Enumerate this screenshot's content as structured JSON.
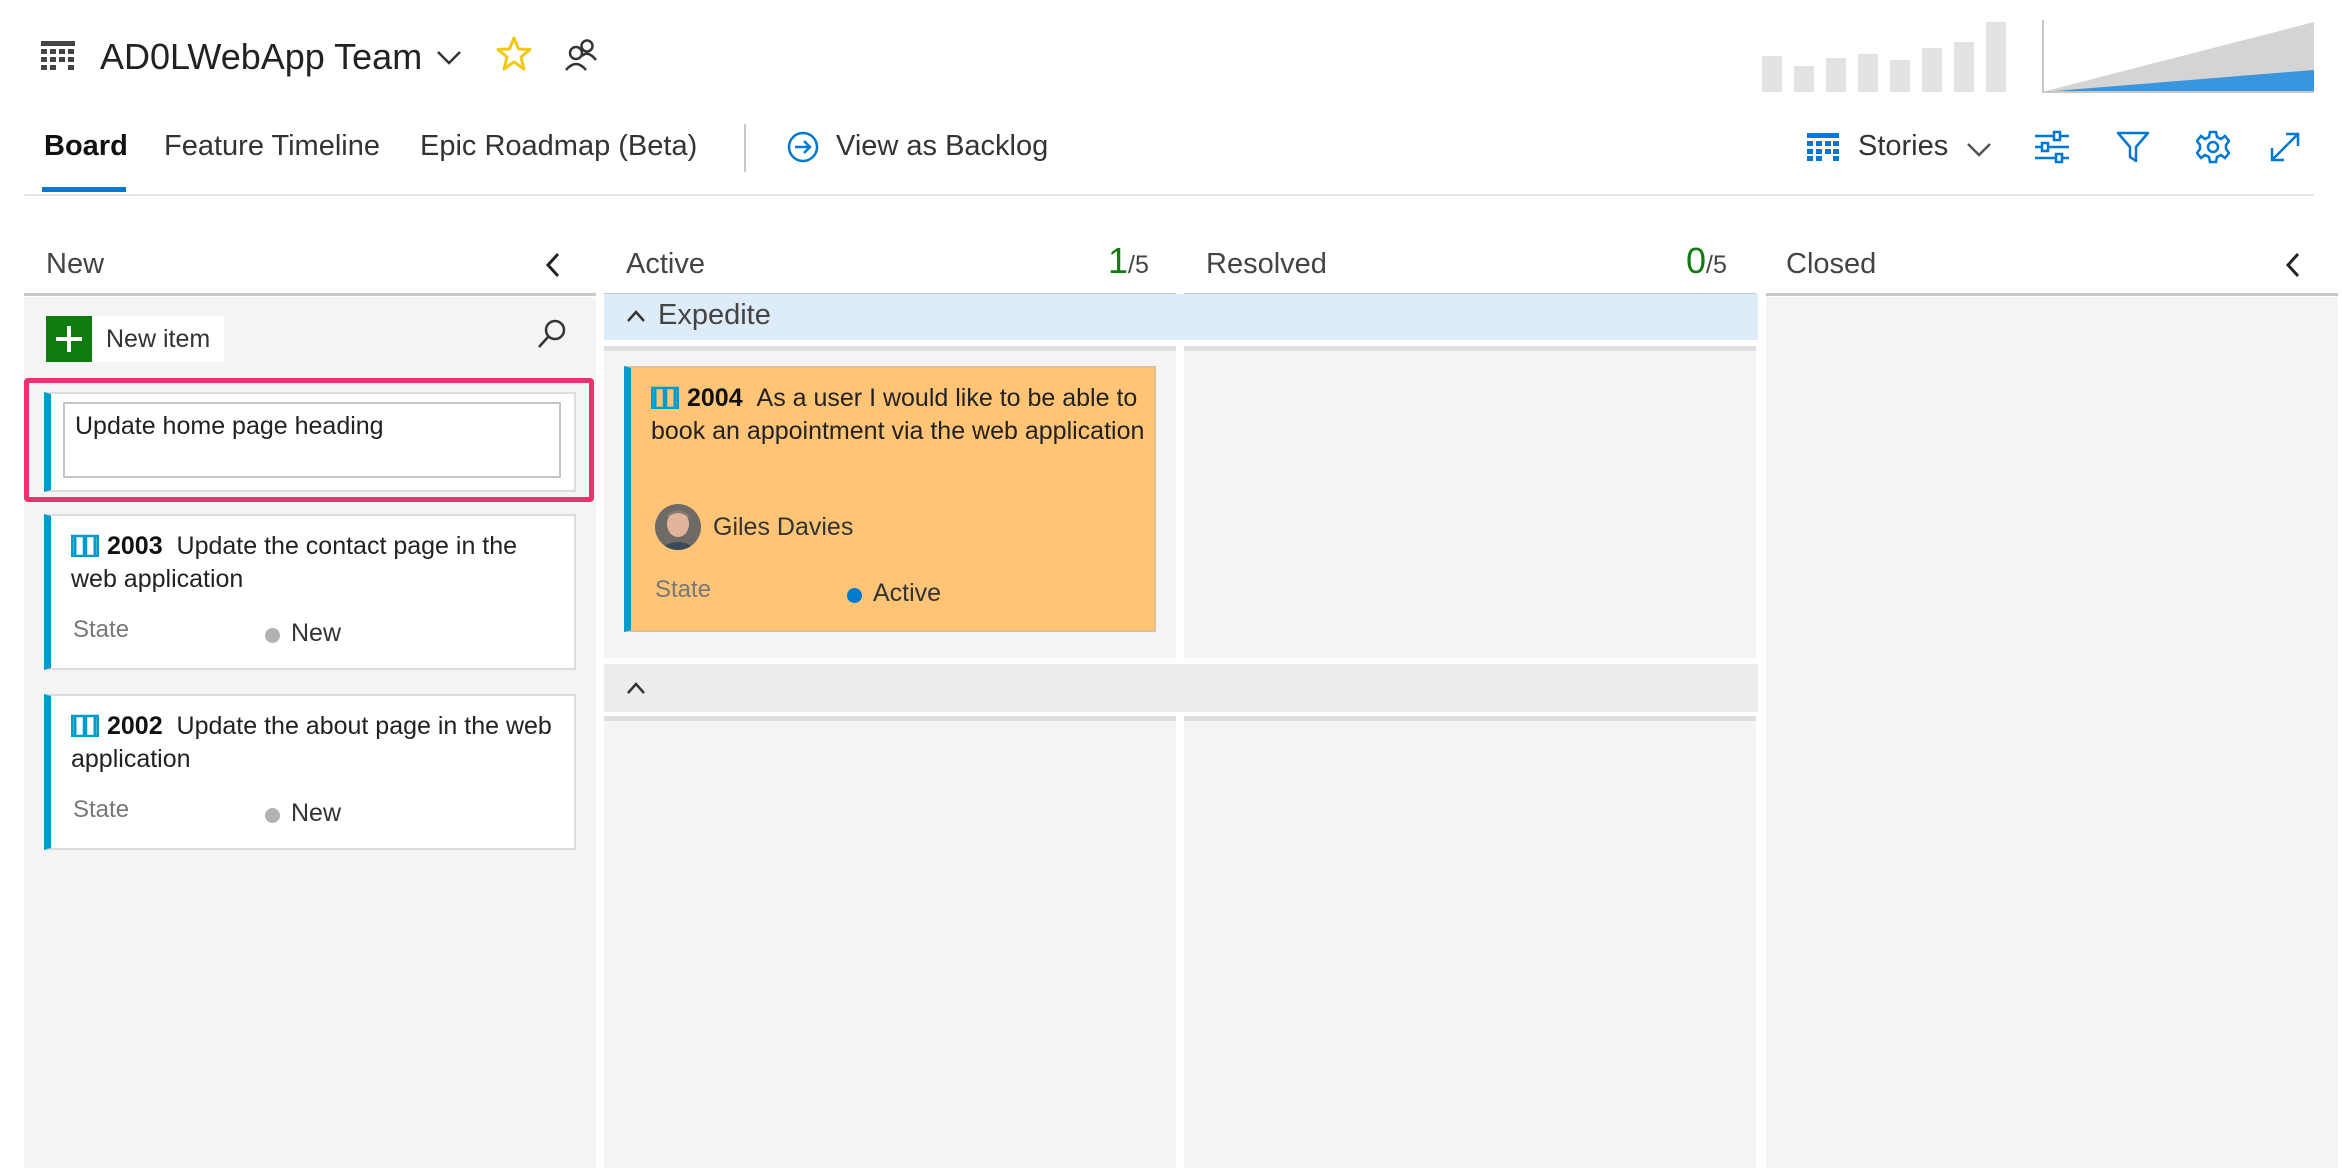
{
  "header": {
    "team_name": "AD0LWebApp Team",
    "icons": [
      "board-grid-icon",
      "chevron-down-icon",
      "favorite-star-icon",
      "team-members-icon"
    ],
    "star_color": "#f2c811"
  },
  "tabs": [
    {
      "label": "Board",
      "active": true
    },
    {
      "label": "Feature Timeline",
      "active": false
    },
    {
      "label": "Epic Roadmap (Beta)",
      "active": false
    }
  ],
  "view_as_backlog": "View as Backlog",
  "toolbar": {
    "backlog_level": "Stories",
    "icons": [
      "board-grid-icon",
      "settings-sliders-icon",
      "filter-icon",
      "gear-icon",
      "expand-icon"
    ]
  },
  "columns": {
    "new": {
      "name": "New"
    },
    "active": {
      "name": "Active",
      "count": "1",
      "limit": "/5"
    },
    "resolved": {
      "name": "Resolved",
      "count": "0",
      "limit": "/5"
    },
    "closed": {
      "name": "Closed"
    }
  },
  "new_item": {
    "label": "New item",
    "editing_value": "Update home page heading"
  },
  "swimlanes": [
    {
      "name": "Expedite"
    },
    {
      "name": ""
    }
  ],
  "cards": [
    {
      "id": "2003",
      "title": "Update the contact page in the web application",
      "field_label": "State",
      "state": "New",
      "state_color": "#b2b2b2"
    },
    {
      "id": "2002",
      "title": "Update the about page in the web application",
      "field_label": "State",
      "state": "New",
      "state_color": "#b2b2b2"
    },
    {
      "id": "2004",
      "title": "As a user I would like to be able to book an appointment via the web application",
      "assignee": "Giles Davies",
      "field_label": "State",
      "state": "Active",
      "state_color": "#007acc"
    }
  ],
  "colors": {
    "accent": "#0078d4",
    "card_border": "#009ccc",
    "active_card_bg": "#ffc476",
    "count_green": "#107c10",
    "highlight": "#e8336f",
    "new_button": "#107c10"
  }
}
